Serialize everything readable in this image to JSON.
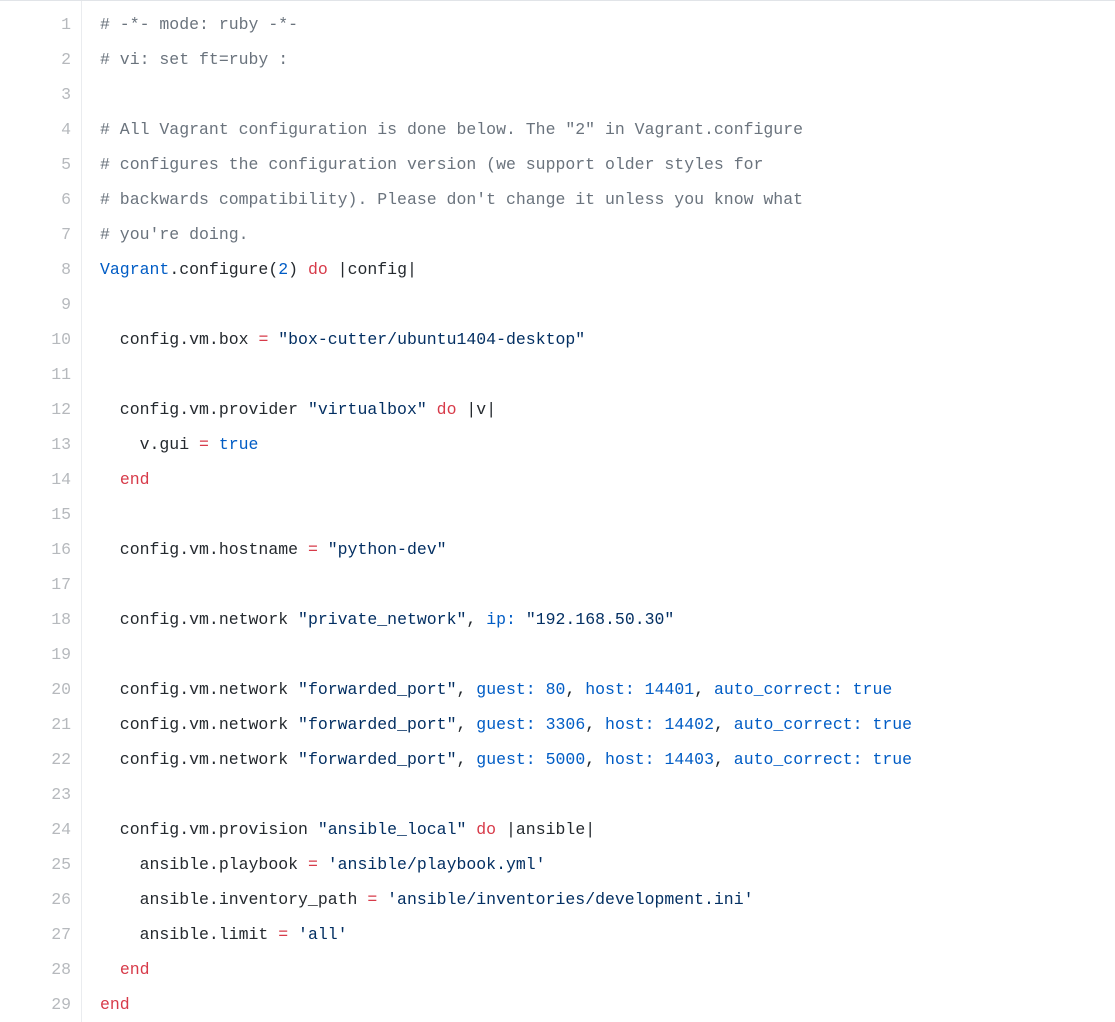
{
  "lines": [
    {
      "n": 1,
      "tokens": [
        [
          "c",
          "# -*- mode: ruby -*-"
        ]
      ]
    },
    {
      "n": 2,
      "tokens": [
        [
          "c",
          "# vi: set ft=ruby :"
        ]
      ]
    },
    {
      "n": 3,
      "tokens": [
        [
          "nm",
          ""
        ]
      ]
    },
    {
      "n": 4,
      "tokens": [
        [
          "c",
          "# All Vagrant configuration is done below. The \"2\" in Vagrant.configure"
        ]
      ]
    },
    {
      "n": 5,
      "tokens": [
        [
          "c",
          "# configures the configuration version (we support older styles for"
        ]
      ]
    },
    {
      "n": 6,
      "tokens": [
        [
          "c",
          "# backwards compatibility). Please don't change it unless you know what"
        ]
      ]
    },
    {
      "n": 7,
      "tokens": [
        [
          "c",
          "# you're doing."
        ]
      ]
    },
    {
      "n": 8,
      "tokens": [
        [
          "cls",
          "Vagrant"
        ],
        [
          "nm",
          ".configure("
        ],
        [
          "fn",
          "2"
        ],
        [
          "nm",
          ") "
        ],
        [
          "kw",
          "do"
        ],
        [
          "nm",
          " |"
        ],
        [
          "nm",
          "config"
        ],
        [
          "nm",
          "|"
        ]
      ]
    },
    {
      "n": 9,
      "tokens": [
        [
          "nm",
          ""
        ]
      ]
    },
    {
      "n": 10,
      "tokens": [
        [
          "nm",
          "  config.vm.box "
        ],
        [
          "kw",
          "="
        ],
        [
          "nm",
          " "
        ],
        [
          "s",
          "\"box-cutter/ubuntu1404-desktop\""
        ]
      ]
    },
    {
      "n": 11,
      "tokens": [
        [
          "nm",
          ""
        ]
      ]
    },
    {
      "n": 12,
      "tokens": [
        [
          "nm",
          "  config.vm.provider "
        ],
        [
          "s",
          "\"virtualbox\""
        ],
        [
          "nm",
          " "
        ],
        [
          "kw",
          "do"
        ],
        [
          "nm",
          " |"
        ],
        [
          "nm",
          "v"
        ],
        [
          "nm",
          "|"
        ]
      ]
    },
    {
      "n": 13,
      "tokens": [
        [
          "nm",
          "    v.gui "
        ],
        [
          "kw",
          "="
        ],
        [
          "nm",
          " "
        ],
        [
          "fn",
          "true"
        ]
      ]
    },
    {
      "n": 14,
      "tokens": [
        [
          "nm",
          "  "
        ],
        [
          "kw",
          "end"
        ]
      ]
    },
    {
      "n": 15,
      "tokens": [
        [
          "nm",
          ""
        ]
      ]
    },
    {
      "n": 16,
      "tokens": [
        [
          "nm",
          "  config.vm.hostname "
        ],
        [
          "kw",
          "="
        ],
        [
          "nm",
          " "
        ],
        [
          "s",
          "\"python-dev\""
        ]
      ]
    },
    {
      "n": 17,
      "tokens": [
        [
          "nm",
          ""
        ]
      ]
    },
    {
      "n": 18,
      "tokens": [
        [
          "nm",
          "  config.vm.network "
        ],
        [
          "s",
          "\"private_network\""
        ],
        [
          "nm",
          ", "
        ],
        [
          "fn",
          "ip:"
        ],
        [
          "nm",
          " "
        ],
        [
          "s",
          "\"192.168.50.30\""
        ]
      ]
    },
    {
      "n": 19,
      "tokens": [
        [
          "nm",
          ""
        ]
      ]
    },
    {
      "n": 20,
      "tokens": [
        [
          "nm",
          "  config.vm.network "
        ],
        [
          "s",
          "\"forwarded_port\""
        ],
        [
          "nm",
          ", "
        ],
        [
          "fn",
          "guest:"
        ],
        [
          "nm",
          " "
        ],
        [
          "fn",
          "80"
        ],
        [
          "nm",
          ", "
        ],
        [
          "fn",
          "host:"
        ],
        [
          "nm",
          " "
        ],
        [
          "fn",
          "14401"
        ],
        [
          "nm",
          ", "
        ],
        [
          "fn",
          "auto_correct:"
        ],
        [
          "nm",
          " "
        ],
        [
          "fn",
          "true"
        ]
      ]
    },
    {
      "n": 21,
      "tokens": [
        [
          "nm",
          "  config.vm.network "
        ],
        [
          "s",
          "\"forwarded_port\""
        ],
        [
          "nm",
          ", "
        ],
        [
          "fn",
          "guest:"
        ],
        [
          "nm",
          " "
        ],
        [
          "fn",
          "3306"
        ],
        [
          "nm",
          ", "
        ],
        [
          "fn",
          "host:"
        ],
        [
          "nm",
          " "
        ],
        [
          "fn",
          "14402"
        ],
        [
          "nm",
          ", "
        ],
        [
          "fn",
          "auto_correct:"
        ],
        [
          "nm",
          " "
        ],
        [
          "fn",
          "true"
        ]
      ]
    },
    {
      "n": 22,
      "tokens": [
        [
          "nm",
          "  config.vm.network "
        ],
        [
          "s",
          "\"forwarded_port\""
        ],
        [
          "nm",
          ", "
        ],
        [
          "fn",
          "guest:"
        ],
        [
          "nm",
          " "
        ],
        [
          "fn",
          "5000"
        ],
        [
          "nm",
          ", "
        ],
        [
          "fn",
          "host:"
        ],
        [
          "nm",
          " "
        ],
        [
          "fn",
          "14403"
        ],
        [
          "nm",
          ", "
        ],
        [
          "fn",
          "auto_correct:"
        ],
        [
          "nm",
          " "
        ],
        [
          "fn",
          "true"
        ]
      ]
    },
    {
      "n": 23,
      "tokens": [
        [
          "nm",
          ""
        ]
      ]
    },
    {
      "n": 24,
      "tokens": [
        [
          "nm",
          "  config.vm.provision "
        ],
        [
          "s",
          "\"ansible_local\""
        ],
        [
          "nm",
          " "
        ],
        [
          "kw",
          "do"
        ],
        [
          "nm",
          " |"
        ],
        [
          "nm",
          "ansible"
        ],
        [
          "nm",
          "|"
        ]
      ]
    },
    {
      "n": 25,
      "tokens": [
        [
          "nm",
          "    ansible.playbook "
        ],
        [
          "kw",
          "="
        ],
        [
          "nm",
          " "
        ],
        [
          "s",
          "'ansible/playbook.yml'"
        ]
      ]
    },
    {
      "n": 26,
      "tokens": [
        [
          "nm",
          "    ansible.inventory_path "
        ],
        [
          "kw",
          "="
        ],
        [
          "nm",
          " "
        ],
        [
          "s",
          "'ansible/inventories/development.ini'"
        ]
      ]
    },
    {
      "n": 27,
      "tokens": [
        [
          "nm",
          "    ansible.limit "
        ],
        [
          "kw",
          "="
        ],
        [
          "nm",
          " "
        ],
        [
          "s",
          "'all'"
        ]
      ]
    },
    {
      "n": 28,
      "tokens": [
        [
          "nm",
          "  "
        ],
        [
          "kw",
          "end"
        ]
      ]
    },
    {
      "n": 29,
      "tokens": [
        [
          "kw",
          "end"
        ]
      ]
    }
  ]
}
